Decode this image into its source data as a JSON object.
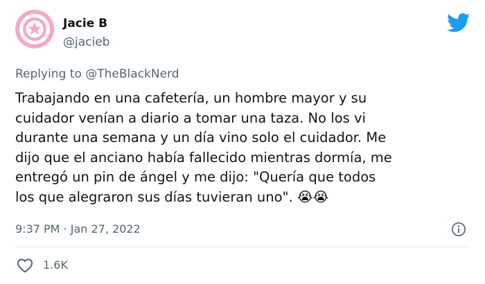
{
  "author": {
    "name": "Jacie B",
    "handle": "@jacieb"
  },
  "reply": {
    "prefix": "Replying to ",
    "mention": "@TheBlackNerd"
  },
  "tweet": {
    "text": "Trabajando en una cafetería, un hombre mayor y su\ncuidador venían a diario a tomar una taza. No los vi\ndurante una semana y un día vino solo el cuidador. Me\ndijo que el anciano había fallecido mientras dormía, me\nentregó un pin de ángel y me dijo: \"Quería que todos\nlos que alegraron sus días tuvieran uno\". 😭😭"
  },
  "meta": {
    "timestamp": "9:37 PM · Jan 27, 2022"
  },
  "stats": {
    "likes": "1.6K"
  },
  "colors": {
    "brand": "#1d9bf0",
    "secondary_text": "#536471",
    "avatar_pink": "#f6b8cf"
  },
  "icons": {
    "logo": "twitter-bird-icon",
    "info": "info-icon",
    "like": "heart-icon"
  }
}
